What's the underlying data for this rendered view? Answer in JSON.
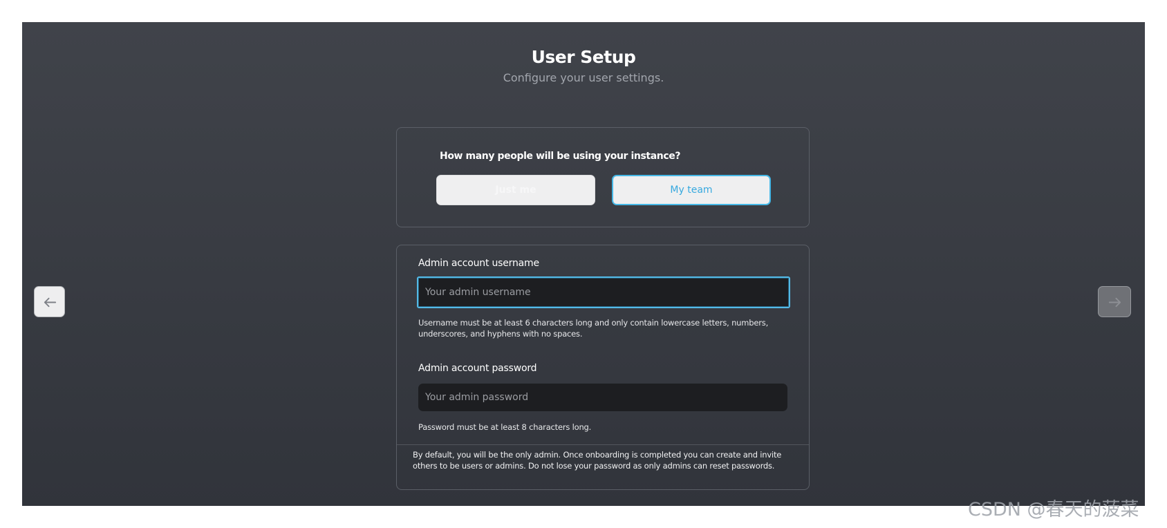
{
  "header": {
    "title": "User Setup",
    "subtitle": "Configure your user settings."
  },
  "usage": {
    "question": "How many people will be using your instance?",
    "options": [
      {
        "label": "Just me",
        "selected": false
      },
      {
        "label": "My team",
        "selected": true
      }
    ]
  },
  "admin": {
    "username_label": "Admin account username",
    "username_placeholder": "Your admin username",
    "username_value": "",
    "username_help": "Username must be at least 6 characters long and only contain lowercase letters, numbers, underscores, and hyphens with no spaces.",
    "password_label": "Admin account password",
    "password_placeholder": "Your admin password",
    "password_value": "",
    "password_help": "Password must be at least 8 characters long.",
    "notice": "By default, you will be the only admin. Once onboarding is completed you can create and invite others to be users or admins. Do not lose your password as only admins can reset passwords."
  },
  "navigation": {
    "back_icon": "arrow-left-icon",
    "next_icon": "arrow-right-icon"
  },
  "watermark": "CSDN @春天的菠菜",
  "colors": {
    "accent": "#45b7e6",
    "background_top": "#40434a",
    "background_bottom": "#31343b"
  }
}
